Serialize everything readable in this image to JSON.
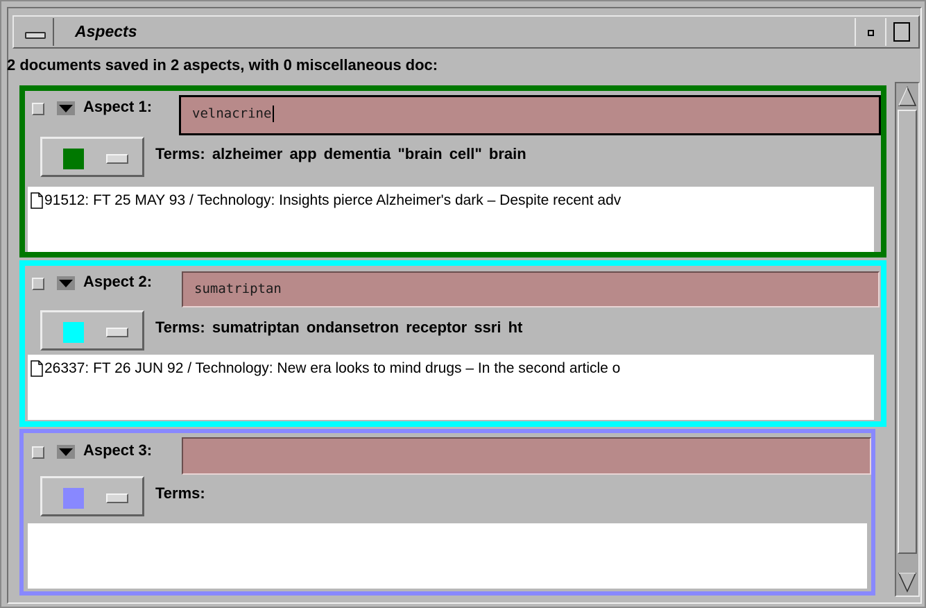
{
  "window": {
    "title": "Aspects"
  },
  "status": "2 documents saved in 2 aspects, with 0 miscellaneous doc:",
  "aspects": [
    {
      "label": "Aspect 1:",
      "query": "velnacrine",
      "color": "#007800",
      "terms": "Terms:  alzheimer  app  dementia  \"brain cell\"  brain",
      "documents": [
        "91512:  FT  25 MAY 93 / Technology: Insights pierce Alzheimer's dark – Despite recent adv"
      ]
    },
    {
      "label": "Aspect 2:",
      "query": "sumatriptan",
      "color": "#00ffff",
      "terms": "Terms:  sumatriptan  ondansetron  receptor  ssri  ht",
      "documents": [
        "26337:  FT  26 JUN 92 / Technology: New era looks to mind drugs – In the second article o"
      ]
    },
    {
      "label": "Aspect 3:",
      "query": "",
      "color": "#8888ff",
      "terms": "Terms:",
      "documents": []
    }
  ]
}
